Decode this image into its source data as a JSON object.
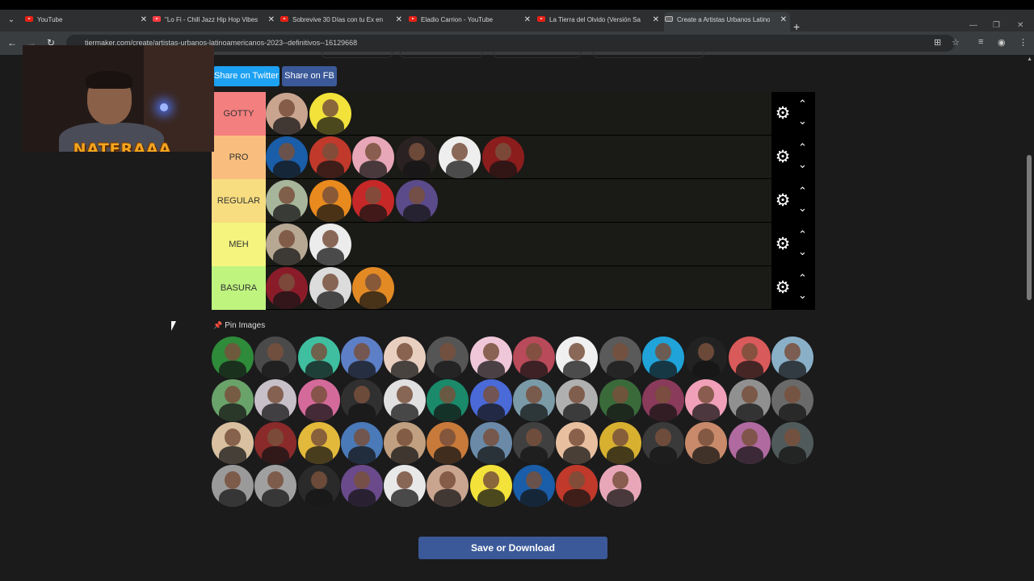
{
  "browser": {
    "tabs": [
      {
        "label": "YouTube",
        "icon": "youtube-icon",
        "active": false
      },
      {
        "label": "\"Lo Fi - Chill Jazz Hip Hop Vibes",
        "icon": "music-icon",
        "active": false
      },
      {
        "label": "Sobrevive 30 Días con tu Ex en",
        "icon": "youtube-icon",
        "active": false
      },
      {
        "label": "Eladio Carrion - YouTube",
        "icon": "youtube-icon",
        "active": false
      },
      {
        "label": "La Tierra del Olvido (Versión Sa",
        "icon": "youtube-icon",
        "active": false
      },
      {
        "label": "Create a Artistas Urbanos Latino",
        "icon": "doc-icon",
        "active": true
      }
    ],
    "url": "tiermaker.com/create/artistas-urbanos-latinoamericanos-2023--definitivos--16129668"
  },
  "share": {
    "twitter": "Share on Twitter",
    "facebook": "Share on FB"
  },
  "tiers": [
    {
      "label": "GOTTY",
      "color": "#f47f7f",
      "count": 2
    },
    {
      "label": "PRO",
      "color": "#f9be7d",
      "count": 6
    },
    {
      "label": "REGULAR",
      "color": "#f7dd7f",
      "count": 4
    },
    {
      "label": "MEH",
      "color": "#f4f47f",
      "count": 2
    },
    {
      "label": "BASURA",
      "color": "#bff47f",
      "count": 3
    }
  ],
  "pin_label": "Pin Images",
  "pool_count": 52,
  "save_label": "Save or Download",
  "webcam": {
    "overlay_name": "NATERAAA"
  }
}
